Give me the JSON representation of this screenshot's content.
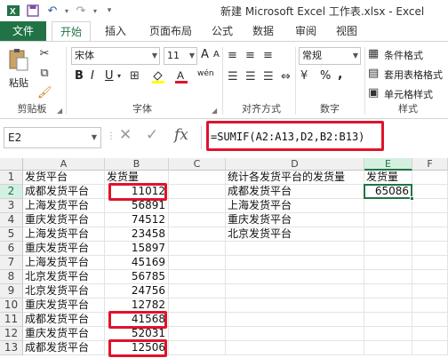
{
  "window": {
    "title": "新建 Microsoft Excel 工作表.xlsx - Excel"
  },
  "ribbon": {
    "tabs": [
      "文件",
      "开始",
      "插入",
      "页面布局",
      "公式",
      "数据",
      "审阅",
      "视图"
    ],
    "active_tab": "开始",
    "paste_label": "粘贴",
    "font_name": "宋体",
    "font_size": "11",
    "font_size_up": "A",
    "font_size_down": "A",
    "bold": "B",
    "italic": "I",
    "underline": "U",
    "wen_label": "wén",
    "number_format": "常规",
    "percent": "%",
    "comma": ",",
    "conditional_format": "条件格式",
    "table_format": "套用表格格式",
    "cell_style": "单元格样式",
    "groups": [
      "剪贴板",
      "字体",
      "对齐方式",
      "数字",
      "样式"
    ]
  },
  "formula_bar": {
    "name_box": "E2",
    "fx": "fx",
    "formula": "=SUMIF(A2:A13,D2,B2:B13)"
  },
  "sheet": {
    "columns": [
      "A",
      "B",
      "C",
      "D",
      "E",
      "F"
    ],
    "selected_column": "E",
    "selected_row": "2",
    "rows": [
      {
        "n": "1",
        "A": "发货平台",
        "B": "发货量",
        "D": "统计各发货平台的发货量",
        "E": "发货量"
      },
      {
        "n": "2",
        "A": "成都发货平台",
        "B": "11012",
        "D": "成都发货平台",
        "E": "65086"
      },
      {
        "n": "3",
        "A": "上海发货平台",
        "B": "56891",
        "D": "上海发货平台",
        "E": ""
      },
      {
        "n": "4",
        "A": "重庆发货平台",
        "B": "74512",
        "D": "重庆发货平台",
        "E": ""
      },
      {
        "n": "5",
        "A": "上海发货平台",
        "B": "23458",
        "D": "北京发货平台",
        "E": ""
      },
      {
        "n": "6",
        "A": "重庆发货平台",
        "B": "15897",
        "D": "",
        "E": ""
      },
      {
        "n": "7",
        "A": "上海发货平台",
        "B": "45169",
        "D": "",
        "E": ""
      },
      {
        "n": "8",
        "A": "北京发货平台",
        "B": "56785",
        "D": "",
        "E": ""
      },
      {
        "n": "9",
        "A": "北京发货平台",
        "B": "24756",
        "D": "",
        "E": ""
      },
      {
        "n": "10",
        "A": "重庆发货平台",
        "B": "12782",
        "D": "",
        "E": ""
      },
      {
        "n": "11",
        "A": "成都发货平台",
        "B": "41568",
        "D": "",
        "E": ""
      },
      {
        "n": "12",
        "A": "重庆发货平台",
        "B": "52031",
        "D": "",
        "E": ""
      },
      {
        "n": "13",
        "A": "成都发货平台",
        "B": "12506",
        "D": "",
        "E": ""
      }
    ]
  },
  "colors": {
    "accent": "#217346",
    "highlight": "#e0132b"
  }
}
